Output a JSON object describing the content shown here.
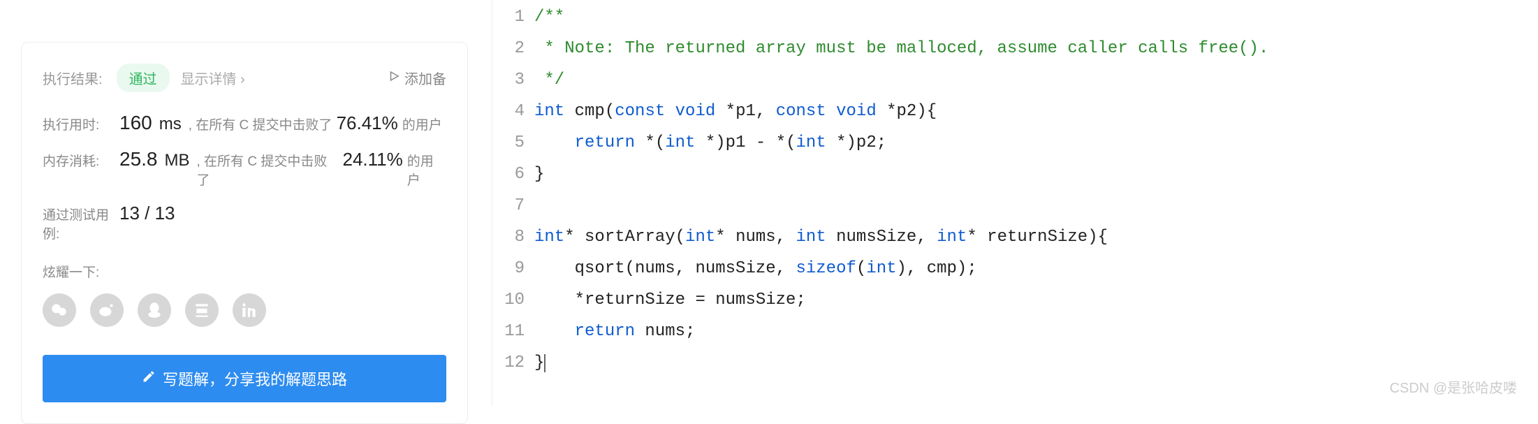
{
  "result": {
    "title_label": "执行结果:",
    "status": "通过",
    "show_details": "显示详情 ›",
    "add_note": "添加备"
  },
  "stats": {
    "runtime_label": "执行用时:",
    "runtime_value": "160",
    "runtime_unit": "ms",
    "runtime_prefix": ", 在所有 C 提交中击败了",
    "runtime_percent": "76.41%",
    "runtime_suffix": "的用户",
    "memory_label": "内存消耗:",
    "memory_value": "25.8",
    "memory_unit": "MB",
    "memory_prefix": ", 在所有 C 提交中击败了",
    "memory_percent": "24.11%",
    "memory_suffix": "的用户",
    "testcase_label": "通过测试用例:",
    "testcase_value": "13 / 13"
  },
  "share": {
    "label": "炫耀一下:"
  },
  "solution_button": "写题解，分享我的解题思路",
  "social": {
    "wechat": "wechat-icon",
    "weibo": "weibo-icon",
    "qq": "qq-icon",
    "douban": "douban-icon",
    "linkedin": "linkedin-icon"
  },
  "code": {
    "language": "c",
    "lines": [
      {
        "n": "1",
        "tokens": [
          {
            "t": "comment",
            "v": "/**"
          }
        ]
      },
      {
        "n": "2",
        "tokens": [
          {
            "t": "comment",
            "v": " * Note: The returned array must be malloced, assume caller calls free()."
          }
        ]
      },
      {
        "n": "3",
        "tokens": [
          {
            "t": "comment",
            "v": " */"
          }
        ]
      },
      {
        "n": "4",
        "tokens": [
          {
            "t": "type",
            "v": "int"
          },
          {
            "t": "plain",
            "v": " cmp("
          },
          {
            "t": "keyword",
            "v": "const"
          },
          {
            "t": "plain",
            "v": " "
          },
          {
            "t": "type",
            "v": "void"
          },
          {
            "t": "plain",
            "v": " *p1, "
          },
          {
            "t": "keyword",
            "v": "const"
          },
          {
            "t": "plain",
            "v": " "
          },
          {
            "t": "type",
            "v": "void"
          },
          {
            "t": "plain",
            "v": " *p2){"
          }
        ]
      },
      {
        "n": "5",
        "tokens": [
          {
            "t": "plain",
            "v": "    "
          },
          {
            "t": "keyword",
            "v": "return"
          },
          {
            "t": "plain",
            "v": " *("
          },
          {
            "t": "type",
            "v": "int"
          },
          {
            "t": "plain",
            "v": " *)p1 - *("
          },
          {
            "t": "type",
            "v": "int"
          },
          {
            "t": "plain",
            "v": " *)p2;"
          }
        ]
      },
      {
        "n": "6",
        "tokens": [
          {
            "t": "plain",
            "v": "}"
          }
        ]
      },
      {
        "n": "7",
        "tokens": [
          {
            "t": "plain",
            "v": ""
          }
        ]
      },
      {
        "n": "8",
        "tokens": [
          {
            "t": "type",
            "v": "int"
          },
          {
            "t": "plain",
            "v": "* sortArray("
          },
          {
            "t": "type",
            "v": "int"
          },
          {
            "t": "plain",
            "v": "* nums, "
          },
          {
            "t": "type",
            "v": "int"
          },
          {
            "t": "plain",
            "v": " numsSize, "
          },
          {
            "t": "type",
            "v": "int"
          },
          {
            "t": "plain",
            "v": "* returnSize){"
          }
        ]
      },
      {
        "n": "9",
        "tokens": [
          {
            "t": "plain",
            "v": "    qsort(nums, numsSize, "
          },
          {
            "t": "keyword",
            "v": "sizeof"
          },
          {
            "t": "plain",
            "v": "("
          },
          {
            "t": "type",
            "v": "int"
          },
          {
            "t": "plain",
            "v": "), cmp);"
          }
        ]
      },
      {
        "n": "10",
        "tokens": [
          {
            "t": "plain",
            "v": "    *returnSize = numsSize;"
          }
        ]
      },
      {
        "n": "11",
        "tokens": [
          {
            "t": "plain",
            "v": "    "
          },
          {
            "t": "keyword",
            "v": "return"
          },
          {
            "t": "plain",
            "v": " nums;"
          }
        ]
      },
      {
        "n": "12",
        "tokens": [
          {
            "t": "plain",
            "v": "}"
          }
        ],
        "cursor": true
      }
    ]
  },
  "watermark": "CSDN @是张哈皮喽"
}
